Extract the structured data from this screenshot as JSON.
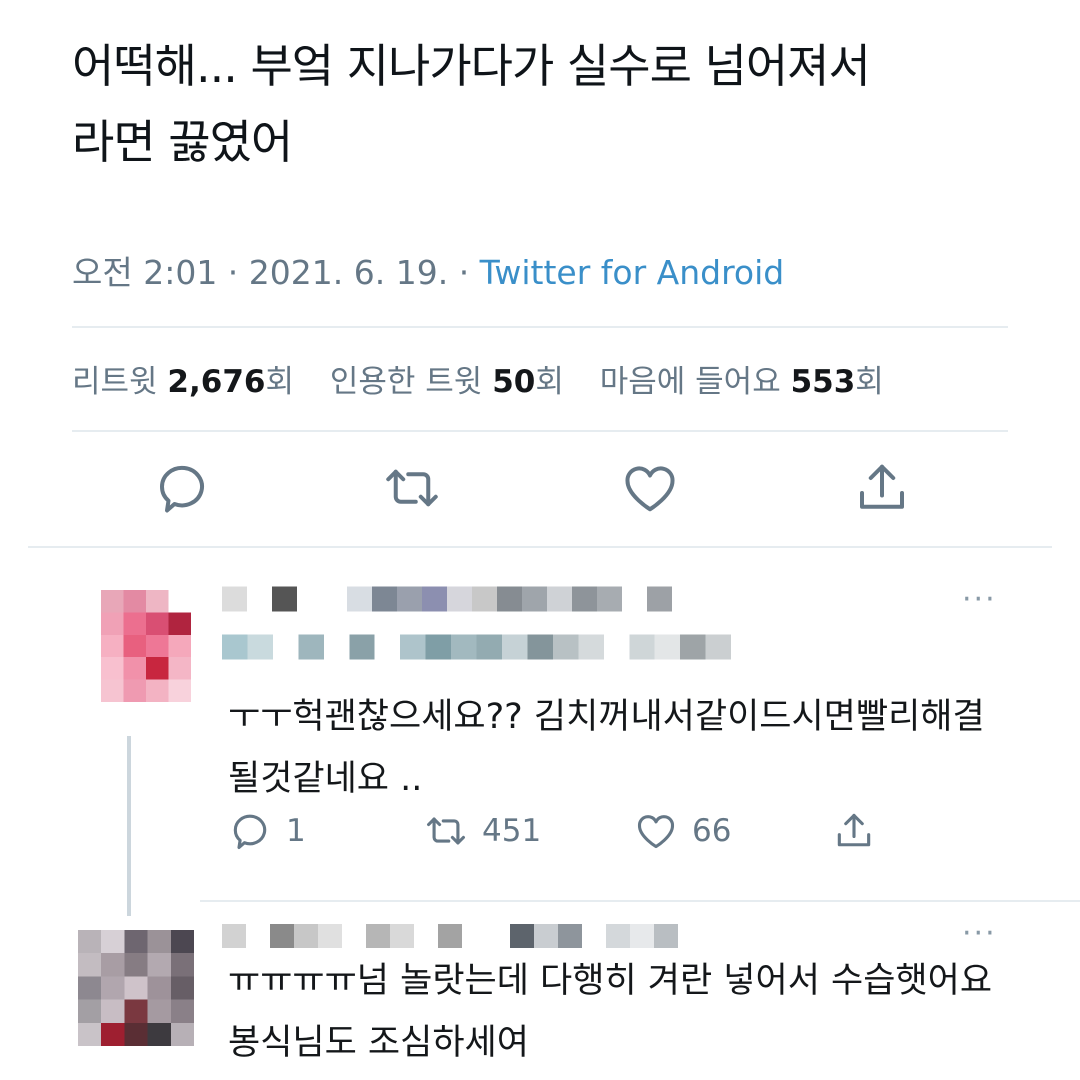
{
  "tweet": {
    "text_line1": "어떡해... 부엌 지나가다가 실수로 넘어져서",
    "text_line2": "라면 끓였어",
    "time": "오전 2:01 · 2021. 6. 19. · ",
    "source": "Twitter for Android"
  },
  "stats": {
    "retweet_label": "리트윗",
    "retweet_count": "2,676",
    "retweet_unit": "회",
    "quote_label": "인용한 트윗",
    "quote_count": "50",
    "quote_unit": "회",
    "like_label": "마음에 들어요",
    "like_count": "553",
    "like_unit": "회"
  },
  "actions": {
    "icons": [
      "reply-icon",
      "retweet-icon",
      "like-icon",
      "share-icon"
    ]
  },
  "replies": [
    {
      "text_line1": "ㅜㅜ헉괜찮으세요?? 김치꺼내서같이드시면빨리해결",
      "text_line2": "될것같네요 ..",
      "reply_count": "1",
      "retweet_count": "451",
      "like_count": "66",
      "more": "···"
    },
    {
      "text_line1": "ㅠㅠㅠㅠ넘 놀랏는데 다행히 겨란 넣어서 수습햇어요",
      "text_line2": "봉식님도 조심하세여",
      "more": "···"
    }
  ],
  "colors": {
    "link": "#3a8fc9",
    "secondary_text": "#657786",
    "divider": "#e6ecf0"
  }
}
